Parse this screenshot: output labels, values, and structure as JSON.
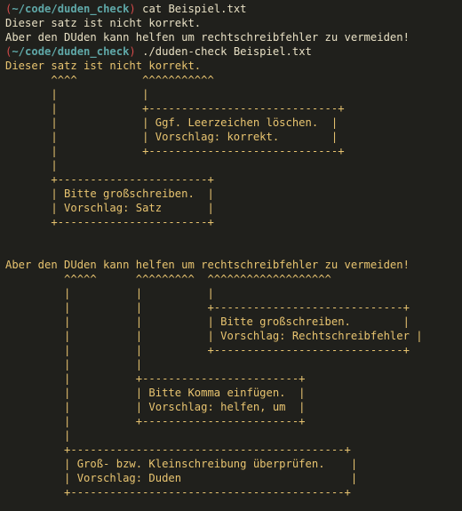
{
  "prompt": {
    "open": "(",
    "path": "~/code/duden_check",
    "close": ")"
  },
  "commands": {
    "cat": "cat Beispiel.txt",
    "check": "./duden-check Beispiel.txt"
  },
  "cat_output": [
    "Dieser satz ist nicht korrekt.",
    "Aber den DUden kann helfen um rechtschreibfehler zu vermeiden!"
  ],
  "check_output": [
    "Dieser satz ist nicht korrekt.",
    "       ^^^^          ^^^^^^^^^^^",
    "       |             |",
    "       |             +-----------------------------+",
    "       |             | Ggf. Leerzeichen löschen.  |",
    "       |             | Vorschlag: korrekt.        |",
    "       |             +-----------------------------+",
    "       |",
    "       +-----------------------+",
    "       | Bitte großschreiben.  |",
    "       | Vorschlag: Satz       |",
    "       +-----------------------+",
    "",
    "",
    "Aber den DUden kann helfen um rechtschreibfehler zu vermeiden!",
    "         ^^^^^      ^^^^^^^^^  ^^^^^^^^^^^^^^^^^^^",
    "         |          |          |",
    "         |          |          +-----------------------------+",
    "         |          |          | Bitte großschreiben.        |",
    "         |          |          | Vorschlag: Rechtschreibfehler |",
    "         |          |          +-----------------------------+",
    "         |          |",
    "         |          +------------------------+",
    "         |          | Bitte Komma einfügen.  |",
    "         |          | Vorschlag: helfen, um  |",
    "         |          +------------------------+",
    "         |",
    "         +------------------------------------------+",
    "         | Groß- bzw. Kleinschreibung überprüfen.    |",
    "         | Vorschlag: Duden                          |",
    "         +------------------------------------------+"
  ],
  "colors": {
    "background": "#20201c",
    "foreground": "#e8e0c4",
    "prompt_paren": "#d24a4a",
    "prompt_path": "#5fa8a8",
    "checker_output": "#e8c470"
  }
}
